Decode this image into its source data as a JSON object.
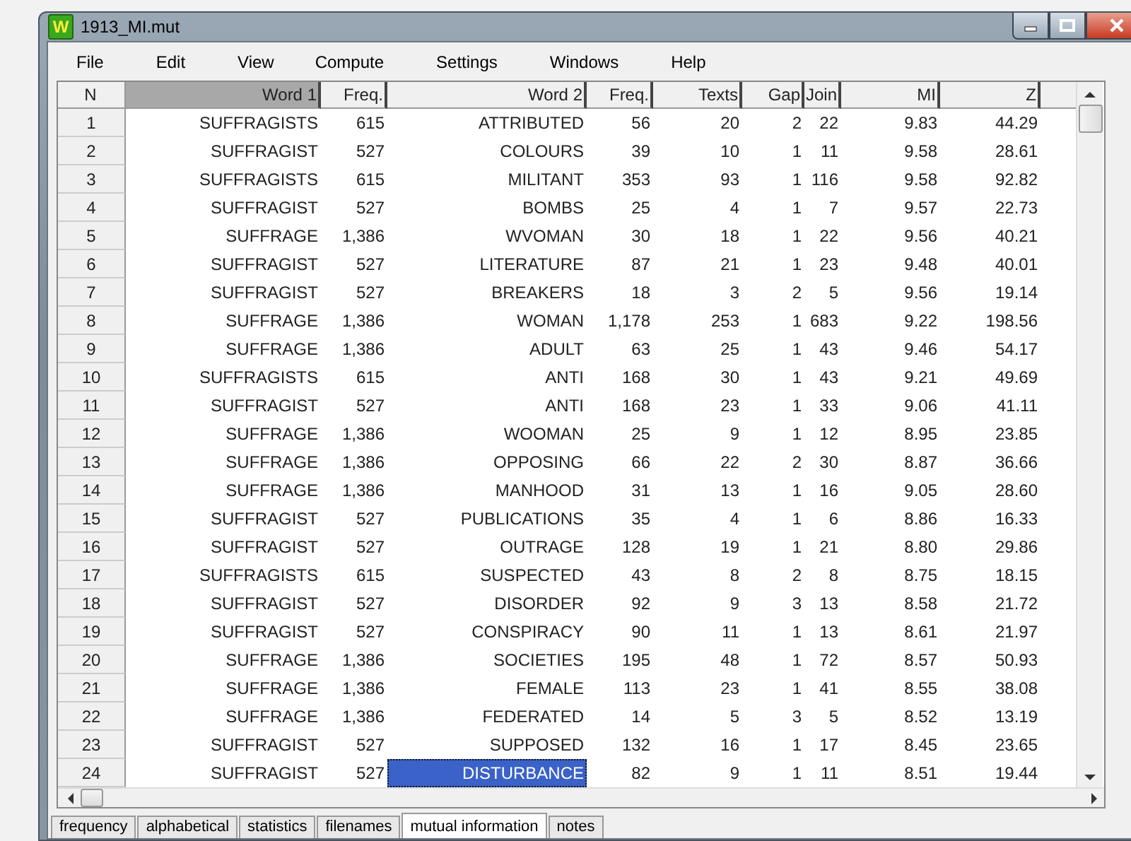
{
  "window": {
    "title": "1913_MI.mut",
    "icon_letter": "W"
  },
  "menu": [
    "File",
    "Edit",
    "View",
    "Compute",
    "Settings",
    "Windows",
    "Help"
  ],
  "table": {
    "columns": [
      {
        "label": "N",
        "selected": false
      },
      {
        "label": "Word 1",
        "selected": true
      },
      {
        "label": "Freq.",
        "selected": false
      },
      {
        "label": "Word 2",
        "selected": false
      },
      {
        "label": "Freq.",
        "selected": false
      },
      {
        "label": "Texts",
        "selected": false
      },
      {
        "label": "Gap",
        "selected": false
      },
      {
        "label": "Join",
        "selected": false
      },
      {
        "label": "MI",
        "selected": false
      },
      {
        "label": "Z",
        "selected": false
      }
    ],
    "rows": [
      {
        "cells": [
          "1",
          "SUFFRAGISTS",
          "615",
          "ATTRIBUTED",
          "56",
          "20",
          "2",
          "22",
          "9.83",
          "44.29"
        ],
        "word2_selected": false
      },
      {
        "cells": [
          "2",
          "SUFFRAGIST",
          "527",
          "COLOURS",
          "39",
          "10",
          "1",
          "11",
          "9.58",
          "28.61"
        ],
        "word2_selected": false
      },
      {
        "cells": [
          "3",
          "SUFFRAGISTS",
          "615",
          "MILITANT",
          "353",
          "93",
          "1",
          "116",
          "9.58",
          "92.82"
        ],
        "word2_selected": false
      },
      {
        "cells": [
          "4",
          "SUFFRAGIST",
          "527",
          "BOMBS",
          "25",
          "4",
          "1",
          "7",
          "9.57",
          "22.73"
        ],
        "word2_selected": false
      },
      {
        "cells": [
          "5",
          "SUFFRAGE",
          "1,386",
          "WVOMAN",
          "30",
          "18",
          "1",
          "22",
          "9.56",
          "40.21"
        ],
        "word2_selected": false
      },
      {
        "cells": [
          "6",
          "SUFFRAGIST",
          "527",
          "LITERATURE",
          "87",
          "21",
          "1",
          "23",
          "9.48",
          "40.01"
        ],
        "word2_selected": false
      },
      {
        "cells": [
          "7",
          "SUFFRAGIST",
          "527",
          "BREAKERS",
          "18",
          "3",
          "2",
          "5",
          "9.56",
          "19.14"
        ],
        "word2_selected": false
      },
      {
        "cells": [
          "8",
          "SUFFRAGE",
          "1,386",
          "WOMAN",
          "1,178",
          "253",
          "1",
          "683",
          "9.22",
          "198.56"
        ],
        "word2_selected": false
      },
      {
        "cells": [
          "9",
          "SUFFRAGE",
          "1,386",
          "ADULT",
          "63",
          "25",
          "1",
          "43",
          "9.46",
          "54.17"
        ],
        "word2_selected": false
      },
      {
        "cells": [
          "10",
          "SUFFRAGISTS",
          "615",
          "ANTI",
          "168",
          "30",
          "1",
          "43",
          "9.21",
          "49.69"
        ],
        "word2_selected": false
      },
      {
        "cells": [
          "11",
          "SUFFRAGIST",
          "527",
          "ANTI",
          "168",
          "23",
          "1",
          "33",
          "9.06",
          "41.11"
        ],
        "word2_selected": false
      },
      {
        "cells": [
          "12",
          "SUFFRAGE",
          "1,386",
          "WOOMAN",
          "25",
          "9",
          "1",
          "12",
          "8.95",
          "23.85"
        ],
        "word2_selected": false
      },
      {
        "cells": [
          "13",
          "SUFFRAGE",
          "1,386",
          "OPPOSING",
          "66",
          "22",
          "2",
          "30",
          "8.87",
          "36.66"
        ],
        "word2_selected": false
      },
      {
        "cells": [
          "14",
          "SUFFRAGE",
          "1,386",
          "MANHOOD",
          "31",
          "13",
          "1",
          "16",
          "9.05",
          "28.60"
        ],
        "word2_selected": false
      },
      {
        "cells": [
          "15",
          "SUFFRAGIST",
          "527",
          "PUBLICATIONS",
          "35",
          "4",
          "1",
          "6",
          "8.86",
          "16.33"
        ],
        "word2_selected": false
      },
      {
        "cells": [
          "16",
          "SUFFRAGIST",
          "527",
          "OUTRAGE",
          "128",
          "19",
          "1",
          "21",
          "8.80",
          "29.86"
        ],
        "word2_selected": false
      },
      {
        "cells": [
          "17",
          "SUFFRAGISTS",
          "615",
          "SUSPECTED",
          "43",
          "8",
          "2",
          "8",
          "8.75",
          "18.15"
        ],
        "word2_selected": false
      },
      {
        "cells": [
          "18",
          "SUFFRAGIST",
          "527",
          "DISORDER",
          "92",
          "9",
          "3",
          "13",
          "8.58",
          "21.72"
        ],
        "word2_selected": false
      },
      {
        "cells": [
          "19",
          "SUFFRAGIST",
          "527",
          "CONSPIRACY",
          "90",
          "11",
          "1",
          "13",
          "8.61",
          "21.97"
        ],
        "word2_selected": false
      },
      {
        "cells": [
          "20",
          "SUFFRAGE",
          "1,386",
          "SOCIETIES",
          "195",
          "48",
          "1",
          "72",
          "8.57",
          "50.93"
        ],
        "word2_selected": false
      },
      {
        "cells": [
          "21",
          "SUFFRAGE",
          "1,386",
          "FEMALE",
          "113",
          "23",
          "1",
          "41",
          "8.55",
          "38.08"
        ],
        "word2_selected": false
      },
      {
        "cells": [
          "22",
          "SUFFRAGE",
          "1,386",
          "FEDERATED",
          "14",
          "5",
          "3",
          "5",
          "8.52",
          "13.19"
        ],
        "word2_selected": false
      },
      {
        "cells": [
          "23",
          "SUFFRAGIST",
          "527",
          "SUPPOSED",
          "132",
          "16",
          "1",
          "17",
          "8.45",
          "23.65"
        ],
        "word2_selected": false
      },
      {
        "cells": [
          "24",
          "SUFFRAGIST",
          "527",
          "DISTURBANCE",
          "82",
          "9",
          "1",
          "11",
          "8.51",
          "19.44"
        ],
        "word2_selected": true
      }
    ]
  },
  "tabs": [
    {
      "label": "frequency",
      "selected": false
    },
    {
      "label": "alphabetical",
      "selected": false
    },
    {
      "label": "statistics",
      "selected": false
    },
    {
      "label": "filenames",
      "selected": false
    },
    {
      "label": "mutual information",
      "selected": true
    },
    {
      "label": "notes",
      "selected": false
    }
  ]
}
